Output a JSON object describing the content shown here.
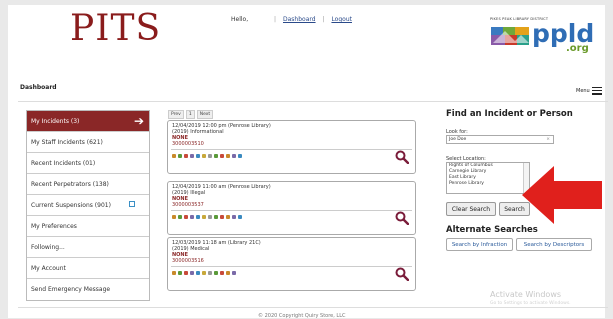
{
  "header": {
    "logo": "PITS",
    "hello": "Hello,",
    "dashboard_link": "Dashboard",
    "logout_link": "Logout",
    "library_district": "PIKES PEAK LIBRARY DISTRICT",
    "ppld": "ppld",
    "org": ".org"
  },
  "page_title": "Dashboard",
  "menu_label": "Menu",
  "sidebar": {
    "items": [
      {
        "label": "My Incidents (3)"
      },
      {
        "label": "My Staff Incidents (621)"
      },
      {
        "label": "Recent Incidents (01)"
      },
      {
        "label": "Recent Perpetrators (138)"
      },
      {
        "label": "Current Suspensions (901)"
      },
      {
        "label": "My Preferences"
      },
      {
        "label": "Following..."
      },
      {
        "label": "My Account"
      },
      {
        "label": "Send Emergency Message"
      }
    ]
  },
  "pager": {
    "prev": "Prev",
    "page": "1",
    "next": "Next"
  },
  "incidents": [
    {
      "line1": "12/04/2019 12:00 pm (Penrose Library)",
      "line2": "(2019) Informational",
      "status": "NONE",
      "number": "3000003510"
    },
    {
      "line1": "12/04/2019 11:00 am (Penrose Library)",
      "line2": "(2019) Illegal",
      "status": "NONE",
      "number": "3000003537"
    },
    {
      "line1": "12/03/2019 11:18 am (Library 21C)",
      "line2": "(2019) Medical",
      "status": "NONE",
      "number": "3000003516"
    }
  ],
  "search_panel": {
    "title": "Find an Incident or Person",
    "look_for_label": "Look for:",
    "look_for_value": "Joe Doe",
    "location_label": "Select Location:",
    "locations": [
      "Rights of Columbus",
      "Carnegie Library",
      "East Library",
      "Penrose Library"
    ],
    "clear_button": "Clear Search",
    "search_button": "Search",
    "alt_title": "Alternate Searches",
    "by_infraction": "Search by Infraction",
    "by_descriptors": "Search by Descriptors"
  },
  "footer": "© 2020 Copyright Quiry Store, LLC",
  "watermark": {
    "line1": "Activate Windows",
    "line2": "Go to Settings to activate Windows."
  },
  "colors": {
    "brand": "#8a1c1c",
    "accent_red": "#e0201c",
    "link": "#2a4a8a"
  }
}
